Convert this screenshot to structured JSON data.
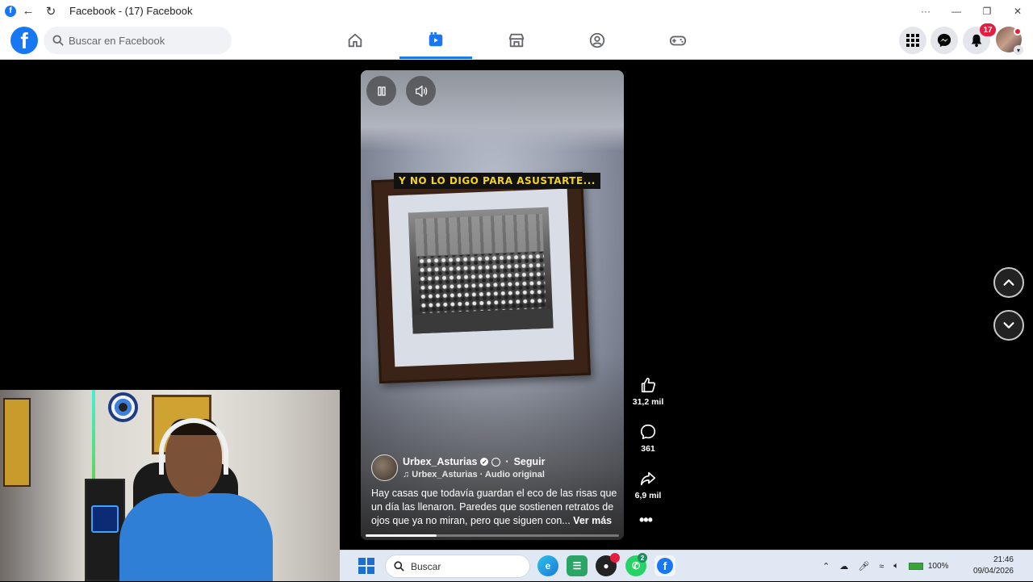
{
  "window": {
    "title": "Facebook - (17) Facebook",
    "fb_icon": "f",
    "controls": [
      "···",
      "—",
      "❐",
      "✕"
    ]
  },
  "header": {
    "logo": "f",
    "search_placeholder": "Buscar en Facebook",
    "tabs": [
      {
        "name": "home",
        "icon": "home-icon"
      },
      {
        "name": "video",
        "icon": "video-icon",
        "active": true
      },
      {
        "name": "marketplace",
        "icon": "marketplace-icon"
      },
      {
        "name": "groups",
        "icon": "groups-icon"
      },
      {
        "name": "gaming",
        "icon": "gaming-icon"
      }
    ],
    "notification_count": "17",
    "accent": "#1877f2"
  },
  "reel": {
    "overlay_text": "Y NO LO DIGO PARA ASUSTARTE...",
    "author": "Urbex_Asturias",
    "follow": "Seguir",
    "audio": "Urbex_Asturias · Audio original",
    "audio_icon": "music-note-icon",
    "description": "Hay casas que todavía guardan el eco de las risas que un día las llenaron. Paredes que sostienen retratos de ojos que ya no miran, pero que siguen con...",
    "see_more": "Ver más",
    "progress_fraction": 0.28
  },
  "actions": {
    "likes": "31,2 mil",
    "comments": "361",
    "shares": "6,9 mil"
  },
  "taskbar": {
    "search_placeholder": "Buscar",
    "whatsapp_badge": "2",
    "battery": "100%",
    "time": "21:46",
    "date": "09/04/2026"
  }
}
